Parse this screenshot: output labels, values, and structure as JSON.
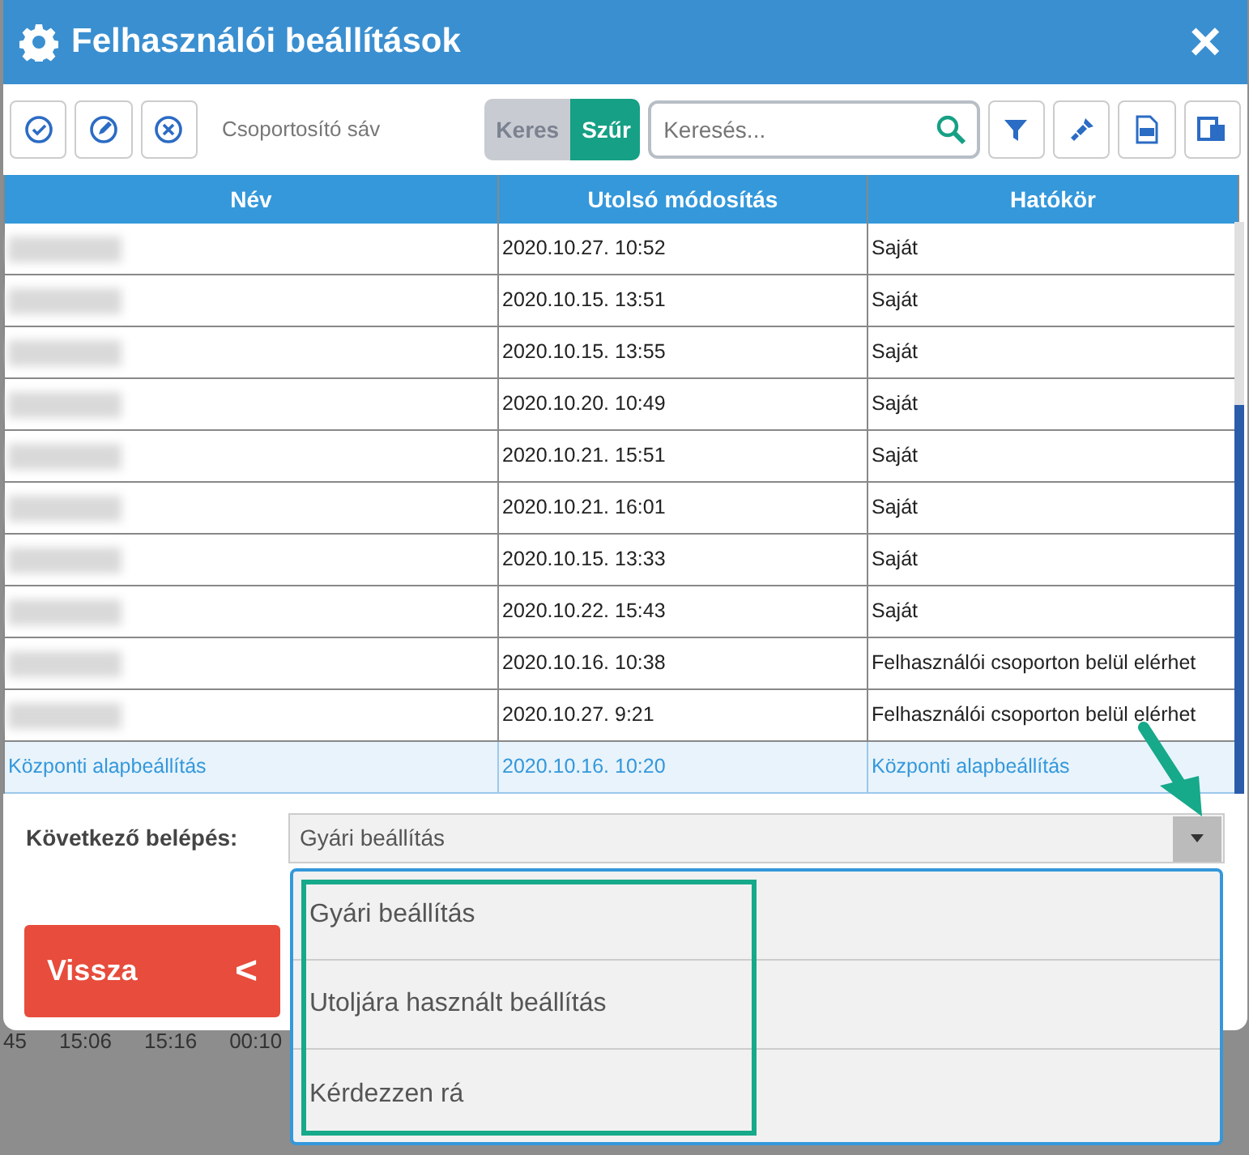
{
  "window": {
    "title": "Felhasználói beállítások",
    "close": "×"
  },
  "toolbar": {
    "grouping_label": "Csoportosító sáv",
    "modes": [
      {
        "label": "Keres",
        "selected": false
      },
      {
        "label": "Szűr",
        "selected": true
      }
    ],
    "search": {
      "placeholder": "Keresés..."
    }
  },
  "table": {
    "columns": [
      "Név",
      "Utolsó módosítás",
      "Hatókör"
    ],
    "rows": [
      {
        "name_blurred": true,
        "modified": "2020.10.27. 10:52",
        "scope": "Saját",
        "selected": false
      },
      {
        "name_blurred": true,
        "modified": "2020.10.15. 13:51",
        "scope": "Saját",
        "selected": false
      },
      {
        "name_blurred": true,
        "modified": "2020.10.15. 13:55",
        "scope": "Saját",
        "selected": false
      },
      {
        "name_blurred": true,
        "modified": "2020.10.20. 10:49",
        "scope": "Saját",
        "selected": false
      },
      {
        "name_blurred": true,
        "modified": "2020.10.21. 15:51",
        "scope": "Saját",
        "selected": false
      },
      {
        "name_blurred": true,
        "modified": "2020.10.21. 16:01",
        "scope": "Saját",
        "selected": false
      },
      {
        "name_blurred": true,
        "modified": "2020.10.15. 13:33",
        "scope": "Saját",
        "selected": false
      },
      {
        "name_blurred": true,
        "modified": "2020.10.22. 15:43",
        "scope": "Saját",
        "selected": false
      },
      {
        "name_blurred": true,
        "modified": "2020.10.16. 10:38",
        "scope": "Felhasználói csoporton belül elérhet",
        "selected": false
      },
      {
        "name_blurred": true,
        "modified": "2020.10.27. 9:21",
        "scope": "Felhasználói csoporton belül elérhet",
        "selected": false
      },
      {
        "name_blurred": false,
        "name": "Központi alapbeállítás",
        "modified": "2020.10.16. 10:20",
        "scope": "Központi alapbeállítás",
        "selected": true
      }
    ]
  },
  "next_login": {
    "label": "Következő belépés:",
    "value": "Gyári beállítás",
    "options": [
      "Gyári beállítás",
      "Utoljára használt beállítás",
      "Kérdezzen rá"
    ]
  },
  "back_button": {
    "label": "Vissza",
    "icon": "<"
  },
  "background": {
    "cells": [
      "45",
      "15:06",
      "15:16",
      "00:10"
    ]
  }
}
